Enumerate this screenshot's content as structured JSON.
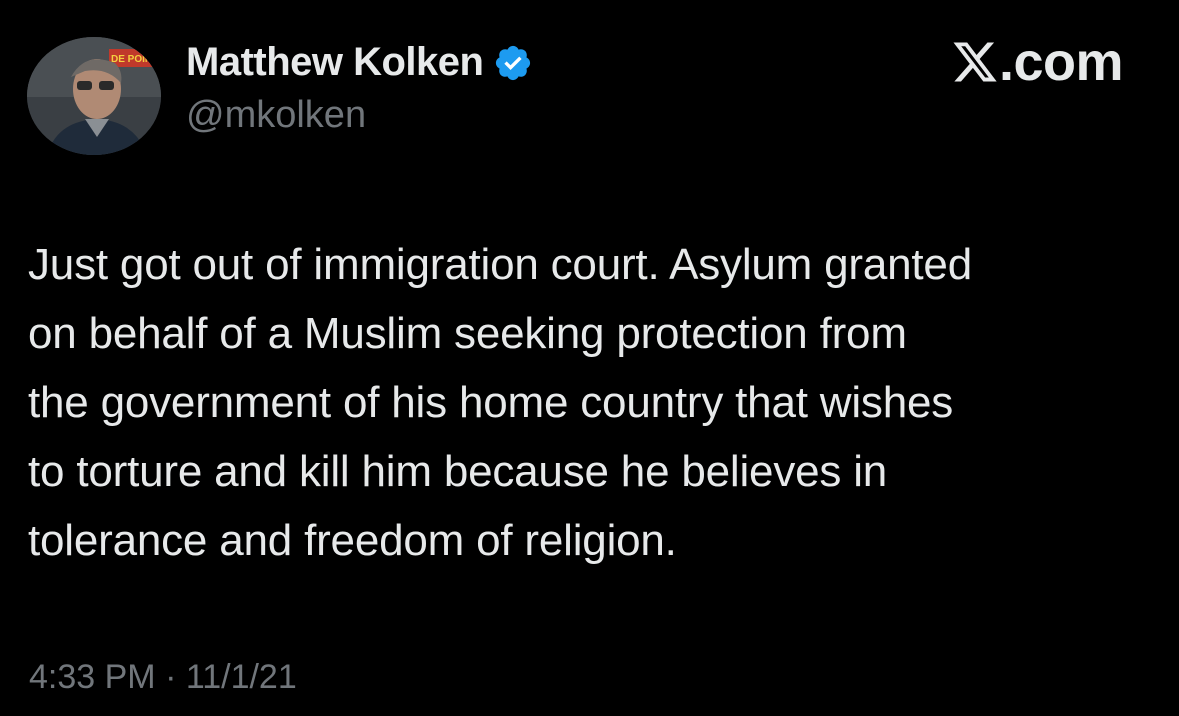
{
  "author": {
    "display_name": "Matthew Kolken",
    "handle": "@mkolken",
    "verified": true,
    "verified_color": "#1d9bf0",
    "avatar_icon": "profile-photo",
    "avatar_sign_text": "DE POINT"
  },
  "brand": {
    "logo_icon": "x-logo-icon",
    "suffix": ".com"
  },
  "tweet": {
    "lines": [
      "Just got out of immigration court. Asylum granted",
      "on behalf of a Muslim seeking protection from",
      "the government of his home country that wishes",
      "to torture and kill him because he believes in",
      "tolerance and freedom of religion."
    ]
  },
  "meta": {
    "timestamp": "4:33 PM · 11/1/21"
  },
  "colors": {
    "background": "#000000",
    "text_primary": "#e7e9ea",
    "text_secondary": "#71767b"
  }
}
